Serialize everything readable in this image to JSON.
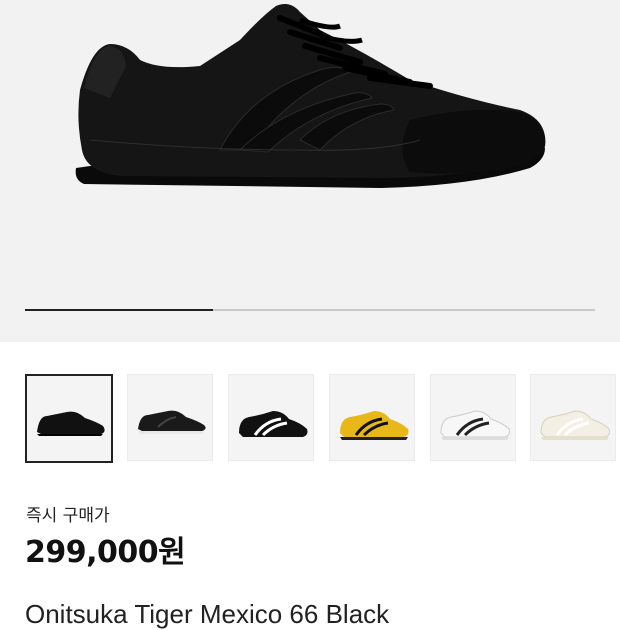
{
  "hero": {
    "image_icon": "black-leather-sneaker-icon",
    "gallery_progress": 0.33
  },
  "thumbnails": [
    {
      "icon": "black-sneaker-icon",
      "colorway": "black",
      "selected": true
    },
    {
      "icon": "black-sneaker-white-sole-icon",
      "colorway": "black/white sole",
      "selected": false
    },
    {
      "icon": "black-white-stripes-sneaker-icon",
      "colorway": "black/white",
      "selected": false
    },
    {
      "icon": "yellow-black-sneaker-icon",
      "colorway": "yellow/black",
      "selected": false
    },
    {
      "icon": "white-black-sneaker-icon",
      "colorway": "white/black",
      "selected": false
    },
    {
      "icon": "cream-white-sneaker-icon",
      "colorway": "cream",
      "selected": false
    }
  ],
  "price": {
    "label": "즉시 구매가",
    "value": "299,000원"
  },
  "product": {
    "title": "Onitsuka Tiger Mexico 66 Black"
  },
  "colors": {
    "hero_bg": "#f2f2f2",
    "accent": "#222222",
    "yellow": "#e8b81a"
  }
}
